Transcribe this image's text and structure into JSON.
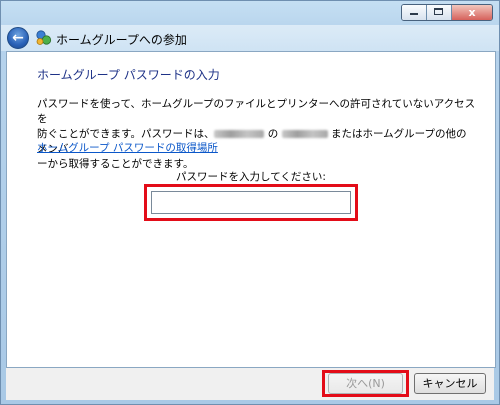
{
  "window": {
    "title": "ホームグループへの参加",
    "caption_buttons": {
      "minimize_icon": "minimize-icon",
      "maximize_icon": "maximize-icon",
      "close_icon": "close-icon",
      "close_glyph": "x"
    }
  },
  "nav": {
    "back_glyph": "←",
    "app_icon": "homegroup-icon"
  },
  "main": {
    "heading": "ホームグループ パスワードの入力",
    "description": {
      "line1": "パスワードを使って、ホームグループのファイルとプリンターへの許可されていないアクセスを",
      "line2_a": "防ぐことができます。パスワードは、",
      "line2_b": " の ",
      "line2_c": " またはホームグループの他のメンバ",
      "line3": "ーから取得することができます。"
    },
    "help_link": "ホームグループ パスワードの取得場所",
    "password_prompt": "パスワードを入力してください:",
    "password_value": ""
  },
  "footer": {
    "next_label": "次へ(N)",
    "cancel_label": "キャンセル"
  },
  "colors": {
    "highlight": "#e30c18",
    "heading": "#1e3287",
    "link": "#0b57c9"
  }
}
